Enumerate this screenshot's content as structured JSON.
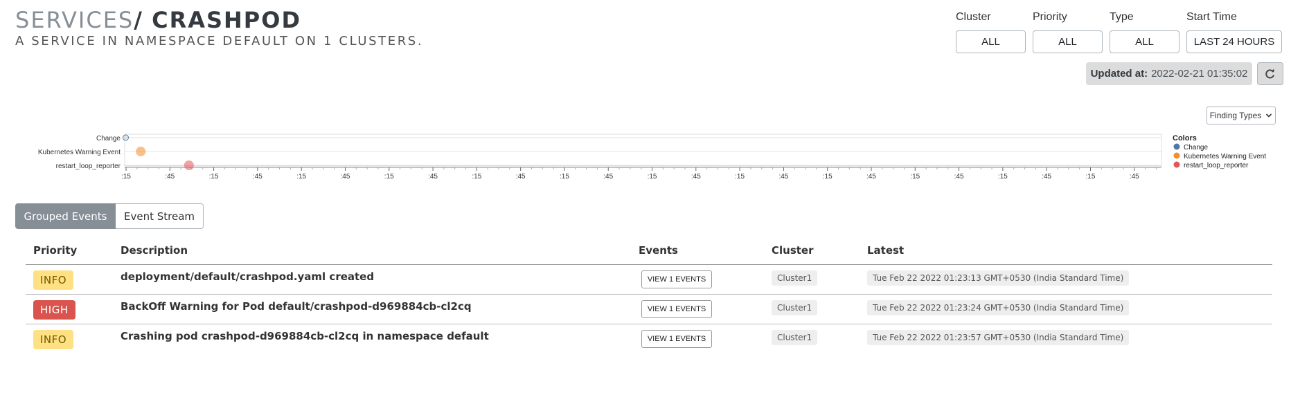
{
  "header": {
    "crumb": "SERVICES",
    "separator": "/",
    "name": "CRASHPOD",
    "subtitle": "A SERVICE IN NAMESPACE DEFAULT ON 1 CLUSTERS."
  },
  "filters": [
    {
      "label": "Cluster",
      "value": "ALL"
    },
    {
      "label": "Priority",
      "value": "ALL"
    },
    {
      "label": "Type",
      "value": "ALL"
    },
    {
      "label": "Start Time",
      "value": "LAST 24 HOURS"
    }
  ],
  "updated": {
    "label": "Updated at:",
    "value": "2022-02-21 01:35:02"
  },
  "finding_types_label": "Finding Types",
  "chart_data": {
    "type": "scatter",
    "categories": [
      "Change",
      "Kubernetes Warning Event",
      "restart_loop_reporter"
    ],
    "x_tick_labels": [
      ":15",
      ":45",
      ":15",
      ":45",
      ":15",
      ":45",
      ":15",
      ":45",
      ":15",
      ":45",
      ":15",
      ":45",
      ":15",
      ":45",
      ":15",
      ":45",
      ":15",
      ":45",
      ":15",
      ":45",
      ":15",
      ":45",
      ":15",
      ":45"
    ],
    "points": [
      {
        "category": "Change",
        "x_fraction": 0.001,
        "color": "#4e79a7"
      },
      {
        "category": "Kubernetes Warning Event",
        "x_fraction": 0.0155,
        "color": "#f28e2b"
      },
      {
        "category": "restart_loop_reporter",
        "x_fraction": 0.062,
        "color": "#e15759"
      }
    ],
    "legend_title": "Colors",
    "legend": [
      {
        "name": "Change",
        "color": "#4e79a7"
      },
      {
        "name": "Kubernetes Warning Event",
        "color": "#f28e2b"
      },
      {
        "name": "restart_loop_reporter",
        "color": "#e15759"
      }
    ],
    "legend_position": "right",
    "grid": true
  },
  "tabs": [
    {
      "label": "Grouped Events",
      "active": true
    },
    {
      "label": "Event Stream",
      "active": false
    }
  ],
  "table": {
    "headers": {
      "priority": "Priority",
      "description": "Description",
      "events": "Events",
      "cluster": "Cluster",
      "latest": "Latest"
    },
    "rows": [
      {
        "priority": "INFO",
        "description": "deployment/default/crashpod.yaml created",
        "events": "VIEW 1 EVENTS",
        "cluster": "Cluster1",
        "latest": "Tue Feb 22 2022 01:23:13 GMT+0530 (India Standard Time)"
      },
      {
        "priority": "HIGH",
        "description": "BackOff Warning for Pod default/crashpod-d969884cb-cl2cq",
        "events": "VIEW 1 EVENTS",
        "cluster": "Cluster1",
        "latest": "Tue Feb 22 2022 01:23:24 GMT+0530 (India Standard Time)"
      },
      {
        "priority": "INFO",
        "description": "Crashing pod crashpod-d969884cb-cl2cq in namespace default",
        "events": "VIEW 1 EVENTS",
        "cluster": "Cluster1",
        "latest": "Tue Feb 22 2022 01:23:57 GMT+0530 (India Standard Time)"
      }
    ]
  }
}
